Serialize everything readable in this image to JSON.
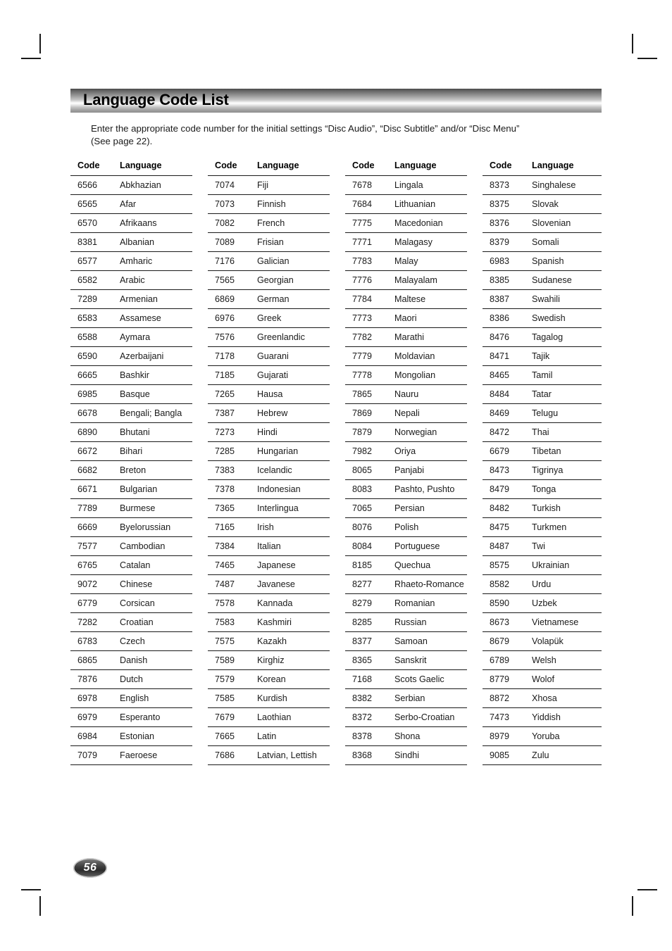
{
  "document": {
    "title": "Language Code List",
    "intro_line1": "Enter the appropriate code number for the initial settings “Disc Audio”, “Disc Subtitle” and/or “Disc Menu”",
    "intro_line2": "(See page 22).",
    "page_number": "56"
  },
  "table": {
    "headers": {
      "code": "Code",
      "language": "Language"
    },
    "columns": [
      {
        "rows": [
          {
            "code": "6566",
            "language": "Abkhazian"
          },
          {
            "code": "6565",
            "language": "Afar"
          },
          {
            "code": "6570",
            "language": "Afrikaans"
          },
          {
            "code": "8381",
            "language": "Albanian"
          },
          {
            "code": "6577",
            "language": "Amharic"
          },
          {
            "code": "6582",
            "language": "Arabic"
          },
          {
            "code": "7289",
            "language": "Armenian"
          },
          {
            "code": "6583",
            "language": "Assamese"
          },
          {
            "code": "6588",
            "language": "Aymara"
          },
          {
            "code": "6590",
            "language": "Azerbaijani"
          },
          {
            "code": "6665",
            "language": "Bashkir"
          },
          {
            "code": "6985",
            "language": "Basque"
          },
          {
            "code": "6678",
            "language": "Bengali; Bangla"
          },
          {
            "code": "6890",
            "language": "Bhutani"
          },
          {
            "code": "6672",
            "language": "Bihari"
          },
          {
            "code": "6682",
            "language": "Breton"
          },
          {
            "code": "6671",
            "language": "Bulgarian"
          },
          {
            "code": "7789",
            "language": "Burmese"
          },
          {
            "code": "6669",
            "language": "Byelorussian"
          },
          {
            "code": "7577",
            "language": "Cambodian"
          },
          {
            "code": "6765",
            "language": "Catalan"
          },
          {
            "code": "9072",
            "language": "Chinese"
          },
          {
            "code": "6779",
            "language": "Corsican"
          },
          {
            "code": "7282",
            "language": "Croatian"
          },
          {
            "code": "6783",
            "language": "Czech"
          },
          {
            "code": "6865",
            "language": "Danish"
          },
          {
            "code": "7876",
            "language": "Dutch"
          },
          {
            "code": "6978",
            "language": "English"
          },
          {
            "code": "6979",
            "language": "Esperanto"
          },
          {
            "code": "6984",
            "language": "Estonian"
          },
          {
            "code": "7079",
            "language": "Faeroese"
          }
        ]
      },
      {
        "rows": [
          {
            "code": "7074",
            "language": "Fiji"
          },
          {
            "code": "7073",
            "language": "Finnish"
          },
          {
            "code": "7082",
            "language": "French"
          },
          {
            "code": "7089",
            "language": "Frisian"
          },
          {
            "code": "7176",
            "language": "Galician"
          },
          {
            "code": "7565",
            "language": "Georgian"
          },
          {
            "code": "6869",
            "language": "German"
          },
          {
            "code": "6976",
            "language": "Greek"
          },
          {
            "code": "7576",
            "language": "Greenlandic"
          },
          {
            "code": "7178",
            "language": "Guarani"
          },
          {
            "code": "7185",
            "language": "Gujarati"
          },
          {
            "code": "7265",
            "language": "Hausa"
          },
          {
            "code": "7387",
            "language": "Hebrew"
          },
          {
            "code": "7273",
            "language": "Hindi"
          },
          {
            "code": "7285",
            "language": "Hungarian"
          },
          {
            "code": "7383",
            "language": "Icelandic"
          },
          {
            "code": "7378",
            "language": "Indonesian"
          },
          {
            "code": "7365",
            "language": "Interlingua"
          },
          {
            "code": "7165",
            "language": "Irish"
          },
          {
            "code": "7384",
            "language": "Italian"
          },
          {
            "code": "7465",
            "language": "Japanese"
          },
          {
            "code": "7487",
            "language": "Javanese"
          },
          {
            "code": "7578",
            "language": "Kannada"
          },
          {
            "code": "7583",
            "language": "Kashmiri"
          },
          {
            "code": "7575",
            "language": "Kazakh"
          },
          {
            "code": "7589",
            "language": "Kirghiz"
          },
          {
            "code": "7579",
            "language": "Korean"
          },
          {
            "code": "7585",
            "language": "Kurdish"
          },
          {
            "code": "7679",
            "language": "Laothian"
          },
          {
            "code": "7665",
            "language": "Latin"
          },
          {
            "code": "7686",
            "language": "Latvian, Lettish"
          }
        ]
      },
      {
        "rows": [
          {
            "code": "7678",
            "language": "Lingala"
          },
          {
            "code": "7684",
            "language": "Lithuanian"
          },
          {
            "code": "7775",
            "language": "Macedonian"
          },
          {
            "code": "7771",
            "language": "Malagasy"
          },
          {
            "code": "7783",
            "language": "Malay"
          },
          {
            "code": "7776",
            "language": "Malayalam"
          },
          {
            "code": "7784",
            "language": "Maltese"
          },
          {
            "code": "7773",
            "language": "Maori"
          },
          {
            "code": "7782",
            "language": "Marathi"
          },
          {
            "code": "7779",
            "language": "Moldavian"
          },
          {
            "code": "7778",
            "language": "Mongolian"
          },
          {
            "code": "7865",
            "language": "Nauru"
          },
          {
            "code": "7869",
            "language": "Nepali"
          },
          {
            "code": "7879",
            "language": "Norwegian"
          },
          {
            "code": "7982",
            "language": "Oriya"
          },
          {
            "code": "8065",
            "language": "Panjabi"
          },
          {
            "code": "8083",
            "language": "Pashto, Pushto"
          },
          {
            "code": "7065",
            "language": "Persian"
          },
          {
            "code": "8076",
            "language": "Polish"
          },
          {
            "code": "8084",
            "language": "Portuguese"
          },
          {
            "code": "8185",
            "language": "Quechua"
          },
          {
            "code": "8277",
            "language": "Rhaeto-Romance"
          },
          {
            "code": "8279",
            "language": "Romanian"
          },
          {
            "code": "8285",
            "language": "Russian"
          },
          {
            "code": "8377",
            "language": "Samoan"
          },
          {
            "code": "8365",
            "language": "Sanskrit"
          },
          {
            "code": "7168",
            "language": "Scots Gaelic"
          },
          {
            "code": "8382",
            "language": "Serbian"
          },
          {
            "code": "8372",
            "language": "Serbo-Croatian"
          },
          {
            "code": "8378",
            "language": "Shona"
          },
          {
            "code": "8368",
            "language": "Sindhi"
          }
        ]
      },
      {
        "rows": [
          {
            "code": "8373",
            "language": "Singhalese"
          },
          {
            "code": "8375",
            "language": "Slovak"
          },
          {
            "code": "8376",
            "language": "Slovenian"
          },
          {
            "code": "8379",
            "language": "Somali"
          },
          {
            "code": "6983",
            "language": "Spanish"
          },
          {
            "code": "8385",
            "language": "Sudanese"
          },
          {
            "code": "8387",
            "language": "Swahili"
          },
          {
            "code": "8386",
            "language": "Swedish"
          },
          {
            "code": "8476",
            "language": "Tagalog"
          },
          {
            "code": "8471",
            "language": "Tajik"
          },
          {
            "code": "8465",
            "language": "Tamil"
          },
          {
            "code": "8484",
            "language": "Tatar"
          },
          {
            "code": "8469",
            "language": "Telugu"
          },
          {
            "code": "8472",
            "language": "Thai"
          },
          {
            "code": "6679",
            "language": "Tibetan"
          },
          {
            "code": "8473",
            "language": "Tigrinya"
          },
          {
            "code": "8479",
            "language": "Tonga"
          },
          {
            "code": "8482",
            "language": "Turkish"
          },
          {
            "code": "8475",
            "language": "Turkmen"
          },
          {
            "code": "8487",
            "language": "Twi"
          },
          {
            "code": "8575",
            "language": "Ukrainian"
          },
          {
            "code": "8582",
            "language": "Urdu"
          },
          {
            "code": "8590",
            "language": "Uzbek"
          },
          {
            "code": "8673",
            "language": "Vietnamese"
          },
          {
            "code": "8679",
            "language": "Volapük"
          },
          {
            "code": "6789",
            "language": "Welsh"
          },
          {
            "code": "8779",
            "language": "Wolof"
          },
          {
            "code": "8872",
            "language": "Xhosa"
          },
          {
            "code": "7473",
            "language": "Yiddish"
          },
          {
            "code": "8979",
            "language": "Yoruba"
          },
          {
            "code": "9085",
            "language": "Zulu"
          }
        ]
      }
    ]
  }
}
